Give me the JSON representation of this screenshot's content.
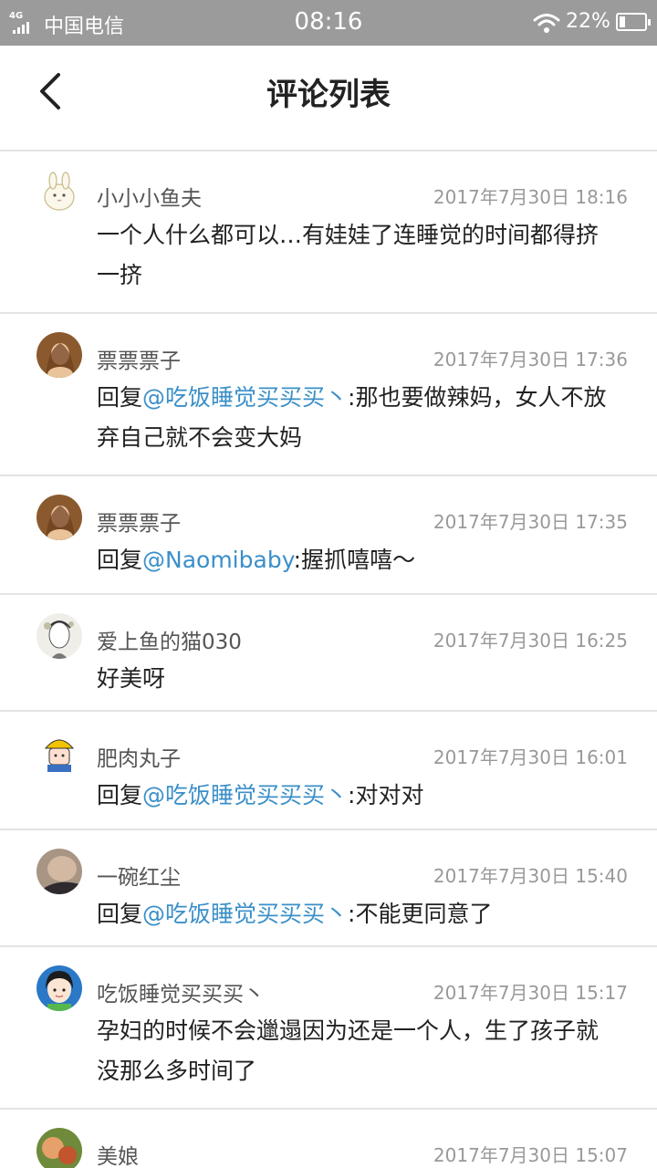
{
  "status_bar": {
    "network": "4G",
    "carrier": "中国电信",
    "time": "08:16",
    "battery": "22%",
    "battery_level": 0.22
  },
  "header": {
    "title": "评论列表",
    "back_icon": "chevron-left-icon"
  },
  "comments": [
    {
      "name": "小小小鱼夫",
      "time": "2017年7月30日 18:16",
      "text": "一个人什么都可以…有娃娃了连睡觉的时间都得挤一挤"
    },
    {
      "name": "票票票子",
      "time": "2017年7月30日 17:36",
      "reply_prefix": "回复",
      "reply_to": "@吃饭睡觉买买买丶",
      "reply_sep": ":",
      "text": "那也要做辣妈，女人不放弃自己就不会变大妈"
    },
    {
      "name": "票票票子",
      "time": "2017年7月30日 17:35",
      "reply_prefix": "回复",
      "reply_to": "@Naomibaby",
      "reply_sep": ":",
      "text": "握抓嘻嘻～"
    },
    {
      "name": "爱上鱼的猫030",
      "time": "2017年7月30日 16:25",
      "text": "好美呀"
    },
    {
      "name": "肥肉丸子",
      "time": "2017年7月30日 16:01",
      "reply_prefix": "回复",
      "reply_to": "@吃饭睡觉买买买丶",
      "reply_sep": ":",
      "text": "对对对"
    },
    {
      "name": "一碗红尘",
      "time": "2017年7月30日 15:40",
      "reply_prefix": "回复",
      "reply_to": "@吃饭睡觉买买买丶",
      "reply_sep": ":",
      "text": "不能更同意了"
    },
    {
      "name": "吃饭睡觉买买买丶",
      "time": "2017年7月30日 15:17",
      "text": "孕妇的时候不会邋遢因为还是一个人，生了孩子就没那么多时间了"
    },
    {
      "name": "美娘",
      "time": "2017年7月30日 15:07",
      "text": ""
    }
  ],
  "colors": {
    "status_bar": "#9b9b9b",
    "mention": "#3a8fc8",
    "divider": "#e3e3e3"
  }
}
